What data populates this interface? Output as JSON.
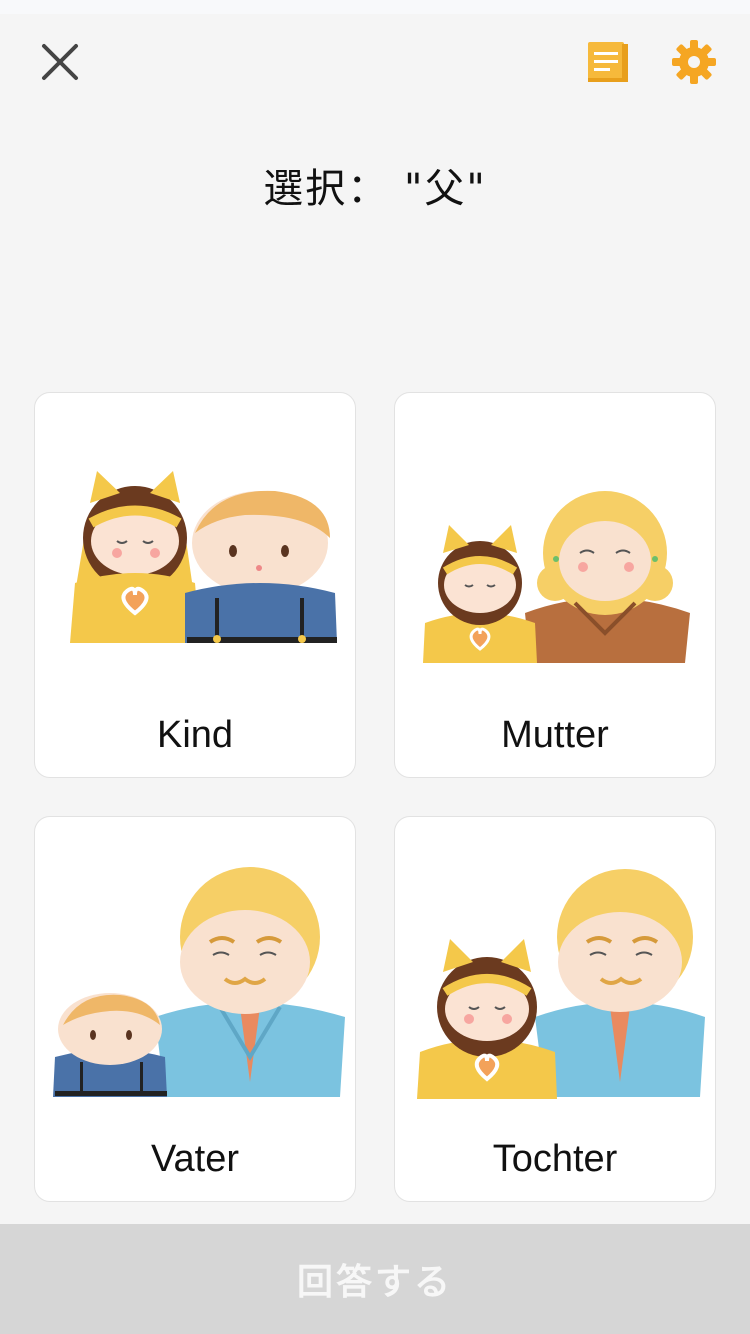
{
  "header": {
    "close_icon": "close-icon",
    "notes_icon": "notes-icon",
    "settings_icon": "gear-icon"
  },
  "prompt": {
    "text": "選択： \"父\""
  },
  "options": [
    {
      "label": "Kind",
      "illustration": "child-and-boy-illustration"
    },
    {
      "label": "Mutter",
      "illustration": "girl-and-mother-illustration"
    },
    {
      "label": "Vater",
      "illustration": "boy-and-father-illustration"
    },
    {
      "label": "Tochter",
      "illustration": "girl-and-father-illustration"
    }
  ],
  "footer": {
    "answer_label": "回答する"
  },
  "colors": {
    "accent": "#f5a623",
    "background": "#f5f5f5",
    "disabled_button": "#d6d6d6",
    "card": "#ffffff"
  }
}
